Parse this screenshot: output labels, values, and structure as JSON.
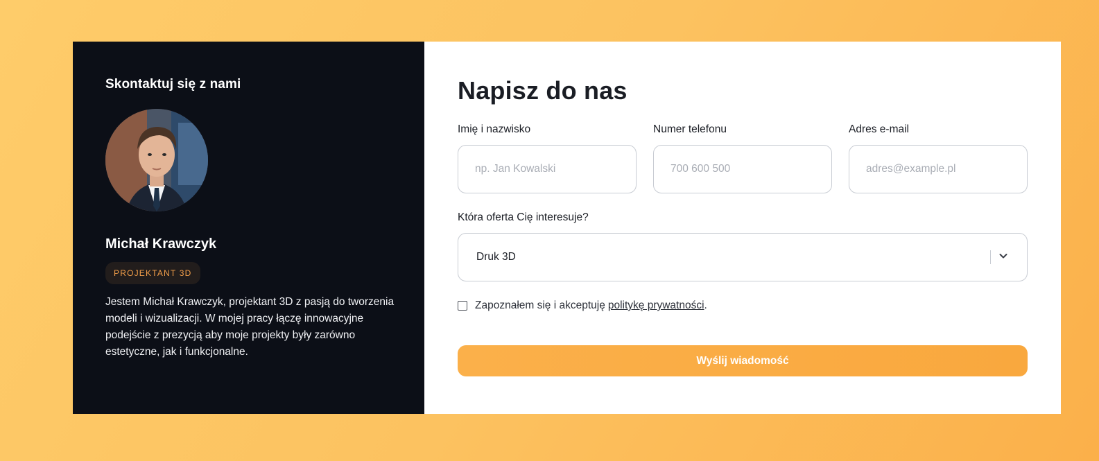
{
  "contact_panel": {
    "heading": "Skontaktuj się z nami",
    "name": "Michał Krawczyk",
    "role": "PROJEKTANT 3D",
    "bio": "Jestem Michał Krawczyk, projektant 3D z pasją do tworzenia modeli i wizualizacji. W mojej pracy łączę innowacyjne podejście z prezycją aby moje projekty były zarówno estetyczne, jak i funkcjonalne."
  },
  "form": {
    "title": "Napisz do nas",
    "fields": [
      {
        "label": "Imię i nazwisko",
        "placeholder": "np. Jan Kowalski",
        "value": ""
      },
      {
        "label": "Numer telefonu",
        "placeholder": "700 600 500",
        "value": ""
      },
      {
        "label": "Adres e-mail",
        "placeholder": "adres@example.pl",
        "value": ""
      }
    ],
    "offer": {
      "label": "Która oferta Cię interesuje?",
      "selected": "Druk 3D",
      "icon": "chevron-down-icon"
    },
    "consent": {
      "text": "Zapoznałem się i akceptuję",
      "link": "politykę prywatności",
      "suffix": ".",
      "checked": false
    },
    "submit_label": "Wyślij wiadomość"
  },
  "colors": {
    "background": "#fcc260",
    "dark_panel": "#0c0f17",
    "accent": "#f9a83e",
    "badge_text": "#f5a04a"
  }
}
